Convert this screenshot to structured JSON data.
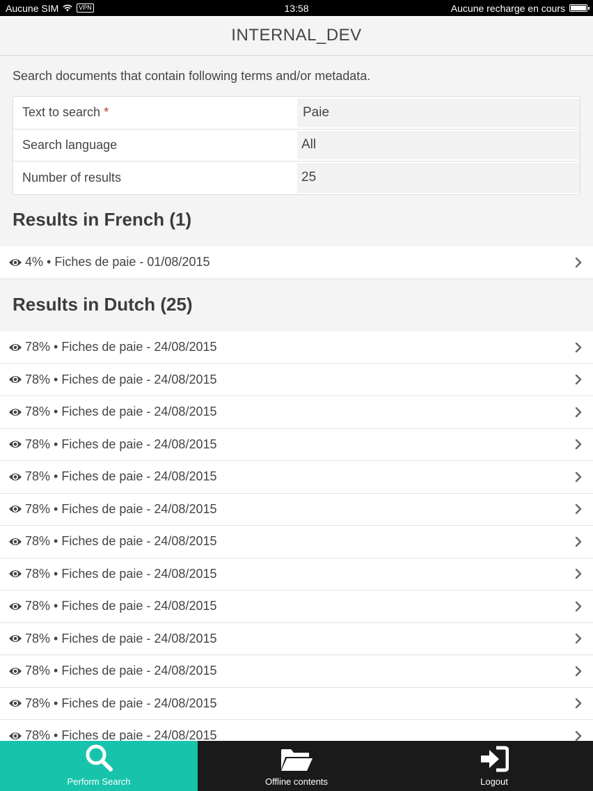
{
  "status_bar": {
    "carrier": "Aucune SIM",
    "vpn": "VPN",
    "time": "13:58",
    "charging": "Aucune recharge en cours"
  },
  "header": {
    "title": "INTERNAL_DEV"
  },
  "search": {
    "intro": "Search documents that contain following terms and/or metadata.",
    "fields": [
      {
        "label": "Text to search",
        "required_mark": "*",
        "value": "Paie"
      },
      {
        "label": "Search language",
        "value": "All"
      },
      {
        "label": "Number of results",
        "value": "25"
      }
    ]
  },
  "results_french": {
    "title": "Results in French (1)",
    "items": [
      "4% • Fiches de paie - 01/08/2015"
    ]
  },
  "results_dutch": {
    "title": "Results in Dutch (25)",
    "items": [
      "78% • Fiches de paie - 24/08/2015",
      "78% • Fiches de paie - 24/08/2015",
      "78% • Fiches de paie - 24/08/2015",
      "78% • Fiches de paie - 24/08/2015",
      "78% • Fiches de paie - 24/08/2015",
      "78% • Fiches de paie - 24/08/2015",
      "78% • Fiches de paie - 24/08/2015",
      "78% • Fiches de paie - 24/08/2015",
      "78% • Fiches de paie - 24/08/2015",
      "78% • Fiches de paie - 24/08/2015",
      "78% • Fiches de paie - 24/08/2015",
      "78% • Fiches de paie - 24/08/2015",
      "78% • Fiches de paie - 24/08/2015"
    ]
  },
  "tabbar": {
    "tabs": [
      {
        "label": "Perform Search",
        "icon": "search-icon",
        "active": true
      },
      {
        "label": "Offline contents",
        "icon": "folder-open-icon",
        "active": false
      },
      {
        "label": "Logout",
        "icon": "logout-icon",
        "active": false
      }
    ],
    "active_color": "#17c3ab"
  }
}
